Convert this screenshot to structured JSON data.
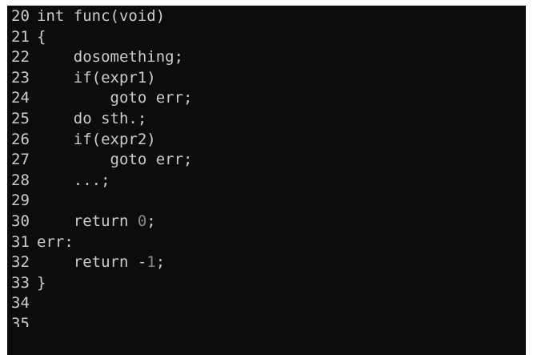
{
  "editor": {
    "lines": [
      {
        "num": "20",
        "text": "int func(void)"
      },
      {
        "num": "21",
        "text": "{"
      },
      {
        "num": "22",
        "text": "    dosomething;"
      },
      {
        "num": "23",
        "text": "    if(expr1)"
      },
      {
        "num": "24",
        "text": "        goto err;"
      },
      {
        "num": "25",
        "text": "    do sth.;"
      },
      {
        "num": "26",
        "text": "    if(expr2)"
      },
      {
        "num": "27",
        "text": "        goto err;"
      },
      {
        "num": "28",
        "text": "    ...;"
      },
      {
        "num": "29",
        "text": ""
      },
      {
        "num": "30",
        "pre": "    return ",
        "lit": "0",
        "post": ";"
      },
      {
        "num": "31",
        "text": "err:"
      },
      {
        "num": "32",
        "pre": "    return -",
        "lit": "1",
        "post": ";"
      },
      {
        "num": "33",
        "text": "}"
      },
      {
        "num": "34",
        "text": ""
      },
      {
        "num": "35",
        "text": ""
      }
    ]
  },
  "colors": {
    "background": "#0c0c0c",
    "foreground": "#cccccc",
    "numeric_literal": "#888888"
  }
}
